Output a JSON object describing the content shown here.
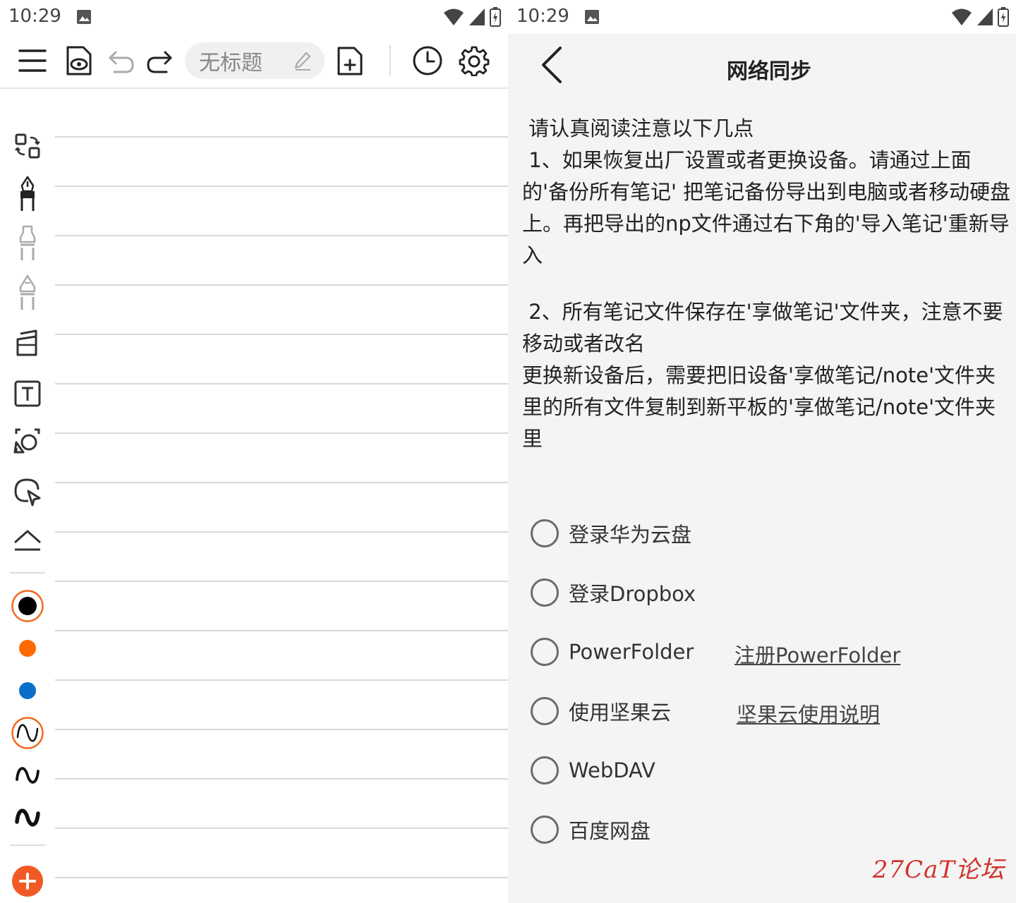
{
  "left_pane": {
    "status": {
      "time": "10:29"
    },
    "toolbar": {
      "note_title": "无标题"
    },
    "colors": {
      "accent": "#f26b21",
      "black": "#000000",
      "orange": "#ff6a00",
      "blue": "#0a6fc9"
    },
    "sidebar_icons": [
      "layout-switch-icon",
      "fountain-pen-icon",
      "marker-icon",
      "highlighter-icon",
      "eraser-icon",
      "text-box-icon",
      "lasso-shape-icon",
      "lasso-select-icon",
      "collapse-icon"
    ],
    "stroke_widths": [
      "thin",
      "medium",
      "thick"
    ]
  },
  "right_pane": {
    "status": {
      "time": "10:29"
    },
    "title": "网络同步",
    "notice": [
      " 请认真阅读注意以下几点",
      " 1、如果恢复出厂设置或者更换设备。请通过上面的'备份所有笔记' 把笔记备份导出到电脑或者移动硬盘上。再把导出的np文件通过右下角的'导入笔记'重新导入",
      " 2、所有笔记文件保存在'享做笔记'文件夹，注意不要移动或者改名",
      "更换新设备后，需要把旧设备'享做笔记/note'文件夹里的所有文件复制到新平板的'享做笔记/note'文件夹里"
    ],
    "options": [
      {
        "label": "登录华为云盘",
        "link": ""
      },
      {
        "label": "登录Dropbox",
        "link": ""
      },
      {
        "label": "PowerFolder",
        "link": "注册PowerFolder"
      },
      {
        "label": "使用坚果云",
        "link": "坚果云使用说明"
      },
      {
        "label": "WebDAV",
        "link": ""
      },
      {
        "label": "百度网盘",
        "link": ""
      }
    ],
    "watermark": "27CaT论坛"
  }
}
